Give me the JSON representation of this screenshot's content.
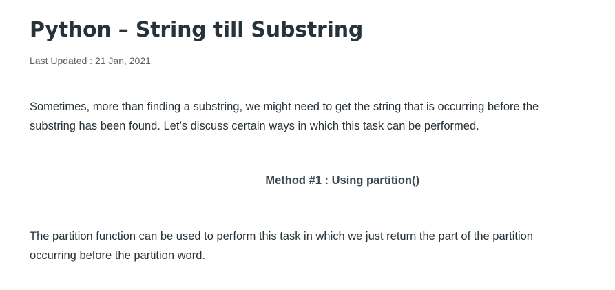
{
  "article": {
    "title": "Python – String till Substring",
    "last_updated": "Last Updated : 21 Jan, 2021",
    "intro_paragraph": "Sometimes, more than finding a substring, we might need to get the string that is occurring before the substring has been found. Let’s discuss certain ways in which this task can be performed.",
    "method_heading": "Method #1 : Using partition()",
    "method_paragraph": "The partition function can be used to perform this task in which we just return the part of the partition occurring before the partition word."
  }
}
